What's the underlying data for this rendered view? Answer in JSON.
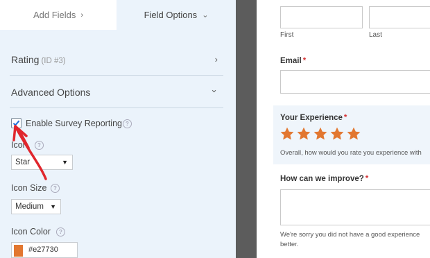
{
  "tabs": {
    "add_fields": "Add Fields",
    "field_options": "Field Options"
  },
  "rating_section": {
    "title": "Rating",
    "id_label": "(ID #3)"
  },
  "advanced_section": {
    "title": "Advanced Options"
  },
  "survey_reporting": {
    "label": "Enable Survey Reporting",
    "checked": true
  },
  "icon": {
    "label": "Icon",
    "value": "Star"
  },
  "icon_size": {
    "label": "Icon Size",
    "value": "Medium"
  },
  "icon_color": {
    "label": "Icon Color",
    "value": "#e27730",
    "swatch": "#e27730"
  },
  "form": {
    "name_first_sublabel": "First",
    "name_last_sublabel": "Last",
    "email_label": "Email",
    "required_mark": "*",
    "experience_label": "Your Experience",
    "rating_value": 5,
    "rating_max": 5,
    "star_color": "#e27730",
    "experience_desc": "Overall, how would you rate you experience with",
    "improve_label": "How can we improve?",
    "improve_desc_line1": "We're sorry you did not have a good experience",
    "improve_desc_line2": "better."
  },
  "colors": {
    "panel_bg": "#ebf3fb",
    "gutter": "#5c5c5c",
    "required": "#d63638",
    "annotation_arrow": "#e0262d"
  }
}
